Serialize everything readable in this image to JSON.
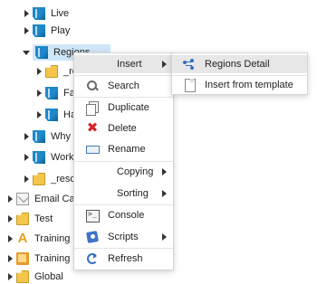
{
  "tree": [
    {
      "label": "Live",
      "icon": "document-blue-icon",
      "arrow": "right"
    },
    {
      "label": "Play",
      "icon": "document-blue-icon",
      "arrow": "right"
    },
    {
      "label": "Regions",
      "icon": "document-blue-icon",
      "arrow": "down",
      "selected": true
    },
    {
      "label": "_re",
      "icon": "folder-icon",
      "arrow": "right"
    },
    {
      "label": "Fai",
      "icon": "document-blue-icon",
      "arrow": "right"
    },
    {
      "label": "Ha",
      "icon": "document-blue-icon",
      "arrow": "right"
    },
    {
      "label": "Why C",
      "icon": "document-blue-icon",
      "arrow": "right"
    },
    {
      "label": "Work",
      "icon": "document-blue-icon",
      "arrow": "right"
    },
    {
      "label": "_reso",
      "icon": "folder-icon",
      "arrow": "right"
    },
    {
      "label": "Email Ca",
      "icon": "envelope-icon",
      "arrow": "right"
    },
    {
      "label": "Test",
      "icon": "folder-icon",
      "arrow": "right"
    },
    {
      "label": "Training",
      "icon": "letter-a-icon",
      "arrow": "right"
    },
    {
      "label": "Training",
      "icon": "book-icon",
      "arrow": "right"
    },
    {
      "label": "Global",
      "icon": "folder-icon",
      "arrow": "right"
    }
  ],
  "context_menu": {
    "items": [
      {
        "label": "Insert",
        "icon": "",
        "submenu": true,
        "hover": true
      },
      {
        "label": "Search",
        "icon": "search-icon"
      },
      {
        "label": "Duplicate",
        "icon": "duplicate-icon"
      },
      {
        "label": "Delete",
        "icon": "delete-icon",
        "glyph": "✖"
      },
      {
        "label": "Rename",
        "icon": "rename-icon"
      },
      {
        "label": "Copying",
        "icon": "",
        "submenu": true
      },
      {
        "label": "Sorting",
        "icon": "",
        "submenu": true
      },
      {
        "label": "Console",
        "icon": "console-icon"
      },
      {
        "label": "Scripts",
        "icon": "scripts-icon",
        "submenu": true
      },
      {
        "label": "Refresh",
        "icon": "refresh-icon"
      }
    ]
  },
  "insert_submenu": {
    "items": [
      {
        "label": "Regions Detail",
        "icon": "regions-detail-icon",
        "hover": true
      },
      {
        "label": "Insert from template",
        "icon": "template-icon"
      }
    ]
  },
  "colors": {
    "selection": "#cfe6f8",
    "menu_hover": "#e7e7e7",
    "delete_red": "#d3262b"
  }
}
